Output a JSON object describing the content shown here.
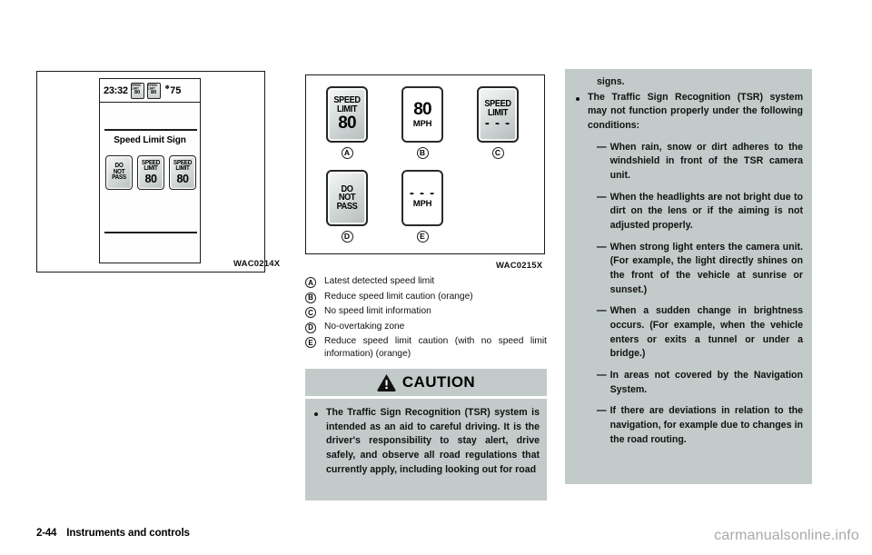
{
  "page": {
    "footer_page_number": "2-44",
    "footer_section": "Instruments and controls",
    "watermark": "carmanualsonline.info"
  },
  "figure1": {
    "caption": "WAC0214X",
    "meter": {
      "clock": "23:32",
      "temperature": "75",
      "snow_icon": "snowflake-icon",
      "title": "Speed Limit Sign",
      "mini_signs": [
        {
          "label": "SPEED LIMIT",
          "value": "80"
        },
        {
          "label": "SPEED LIMIT",
          "value": "80"
        }
      ],
      "signs": [
        {
          "line1": "DO",
          "line2": "NOT",
          "line3": "PASS",
          "type": "no-passing"
        },
        {
          "label_line1": "SPEED",
          "label_line2": "LIMIT",
          "value": "80",
          "type": "speed-limit"
        },
        {
          "label_line1": "SPEED",
          "label_line2": "LIMIT",
          "value": "80",
          "type": "speed-limit"
        }
      ]
    }
  },
  "figure2": {
    "caption": "WAC0215X",
    "signs": [
      {
        "key": "A",
        "style": "gray",
        "label_line1": "SPEED",
        "label_line2": "LIMIT",
        "value": "80"
      },
      {
        "key": "B",
        "style": "white",
        "value": "80",
        "unit": "MPH"
      },
      {
        "key": "C",
        "style": "gray",
        "label_line1": "SPEED",
        "label_line2": "LIMIT",
        "value": "- - -"
      },
      {
        "key": "D",
        "style": "gray",
        "line1": "DO",
        "line2": "NOT",
        "line3": "PASS"
      },
      {
        "key": "E",
        "style": "white",
        "value": "- - -",
        "unit": "MPH"
      }
    ]
  },
  "legend": [
    {
      "key": "A",
      "text": "Latest detected speed limit"
    },
    {
      "key": "B",
      "text": "Reduce speed limit caution (orange)"
    },
    {
      "key": "C",
      "text": "No speed limit information"
    },
    {
      "key": "D",
      "text": "No-overtaking zone"
    },
    {
      "key": "E",
      "text": "Reduce speed limit caution (with no speed limit information) (orange)"
    }
  ],
  "caution": {
    "title": "CAUTION",
    "icon": "warning-triangle-icon",
    "bullet1": "The Traffic Sign Recognition (TSR) system is intended as an aid to careful driving. It is the driver's responsibility to stay alert, drive safely, and observe all road regulations that currently apply, including looking out for road"
  },
  "right_column": {
    "continuation": "signs.",
    "bullet2": "The Traffic Sign Recognition (TSR) system may not function properly under the following conditions:",
    "dash_items": [
      {
        "mark": "—",
        "text": "When rain, snow or dirt adheres to the windshield in front of the TSR camera unit."
      },
      {
        "mark": "—",
        "text": "When the headlights are not bright due to dirt on the lens or if the aiming is not adjusted properly."
      },
      {
        "mark": "—",
        "text": "When strong light enters the camera unit. (For example, the light directly shines on the front of the vehicle at sunrise or sunset.)"
      },
      {
        "mark": "—",
        "text": "When a sudden change in brightness occurs. (For example, when the vehicle enters or exits a tunnel or under a bridge.)"
      },
      {
        "mark": "—",
        "text": "In areas not covered by the Navigation System."
      },
      {
        "mark": "—",
        "text": "If there are deviations in relation to the navigation, for example due to changes in the road routing."
      }
    ]
  },
  "colors": {
    "panel_gray": "#c2cbc9",
    "ink": "#111111",
    "watermark_gray": "#a9a9a9"
  }
}
